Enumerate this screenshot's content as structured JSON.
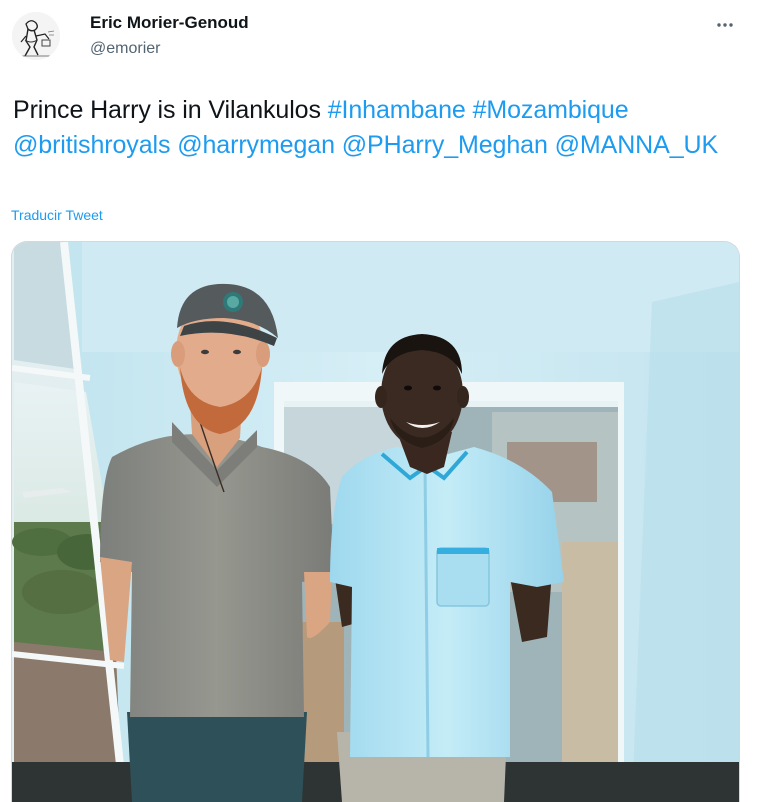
{
  "author": {
    "display_name": "Eric Morier-Genoud",
    "handle": "@emorier",
    "avatar_icon": "sketch-figure-avatar"
  },
  "menu": {
    "icon": "more-horizontal-icon"
  },
  "tweet": {
    "segments": [
      {
        "text": "Prince Harry is in Vilankulos ",
        "link": false
      },
      {
        "text": "#Inhambane",
        "link": true
      },
      {
        "text": " ",
        "link": false
      },
      {
        "text": "#Mozambique",
        "link": true
      },
      {
        "text": " ",
        "link": false
      },
      {
        "text": "@britishroyals",
        "link": true
      },
      {
        "text": " ",
        "link": false
      },
      {
        "text": "@harrymegan",
        "link": true
      },
      {
        "text": " ",
        "link": false
      },
      {
        "text": "@PHarry_Meghan",
        "link": true
      },
      {
        "text": " ",
        "link": false
      },
      {
        "text": "@MANNA_UK",
        "link": true
      }
    ],
    "translate_label": "Traducir Tweet"
  },
  "colors": {
    "link": "#1d9bf0",
    "text": "#0f1419",
    "secondary": "#536471"
  }
}
